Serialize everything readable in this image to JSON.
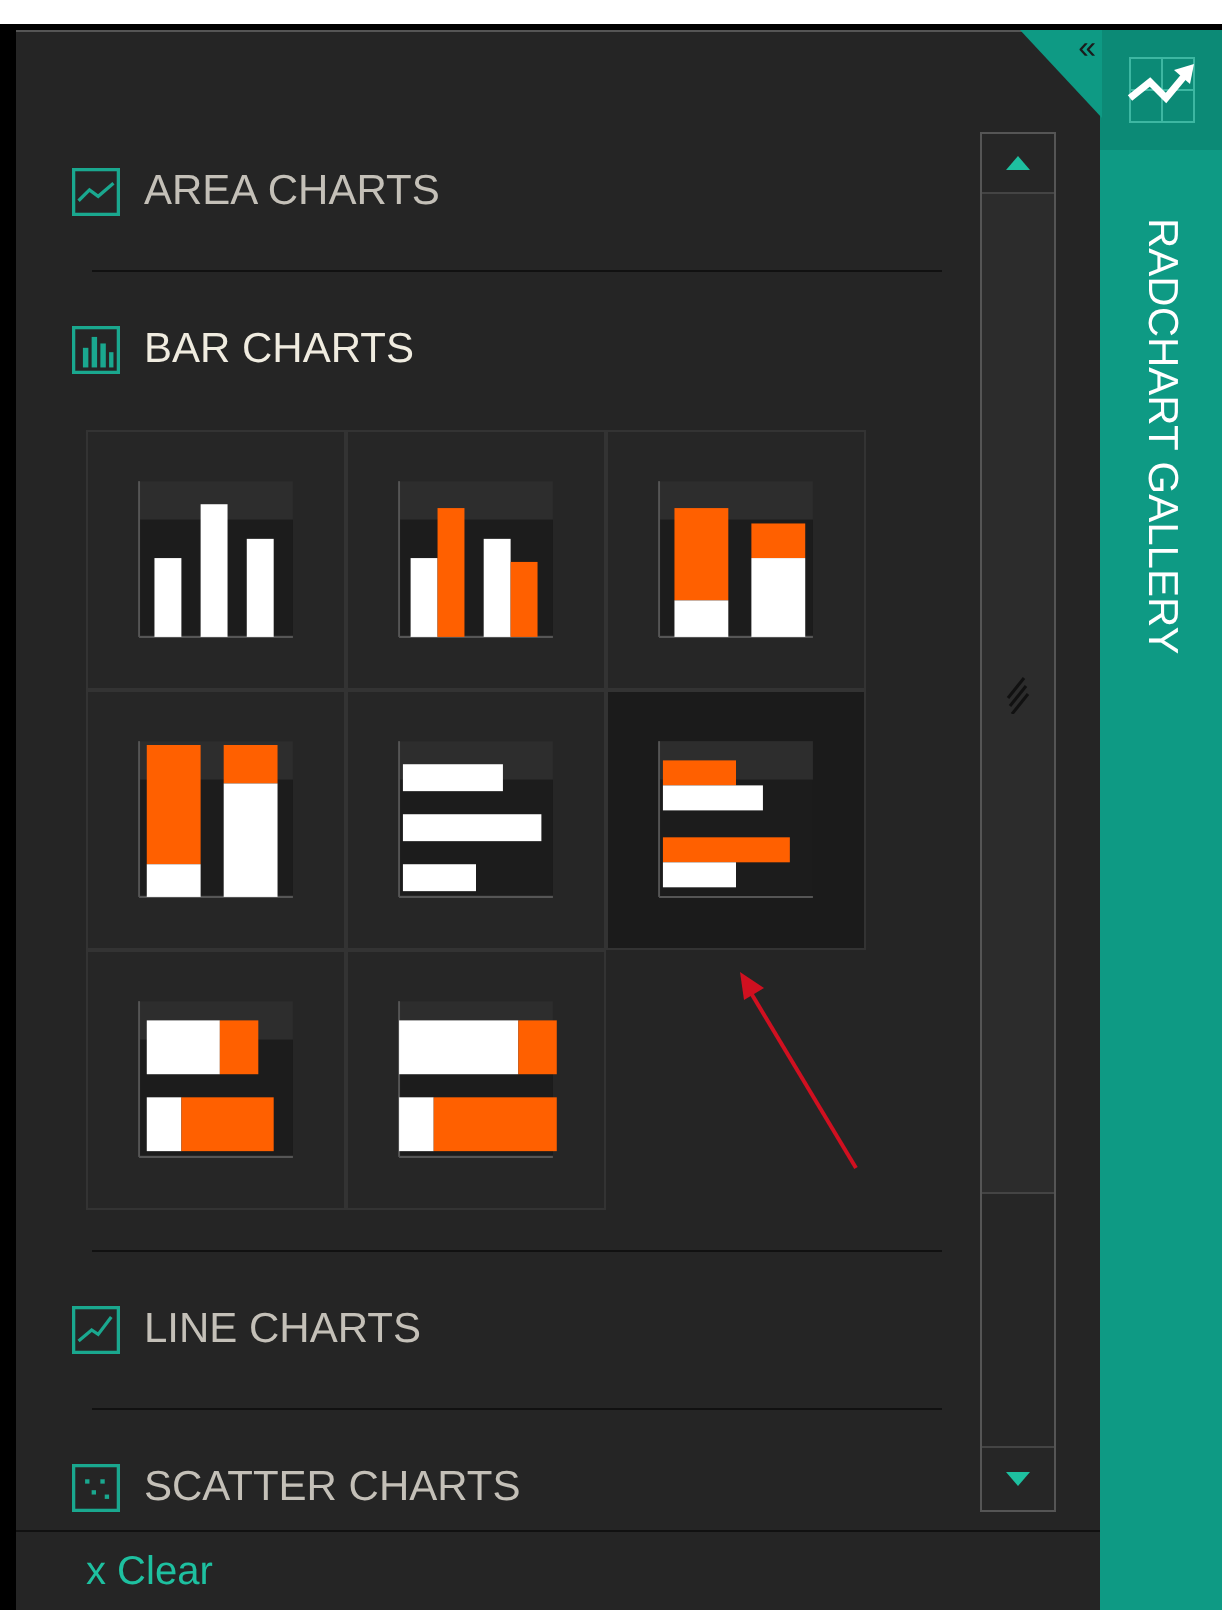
{
  "sections": [
    {
      "kind": "area",
      "label": "AREA CHARTS",
      "expanded": false
    },
    {
      "kind": "bar",
      "label": "BAR CHARTS",
      "expanded": true,
      "thumbnails": [
        {
          "kind": "column",
          "selected": false
        },
        {
          "kind": "clustered-column",
          "selected": false
        },
        {
          "kind": "stacked-column",
          "selected": false
        },
        {
          "kind": "stacked-column-100",
          "selected": false
        },
        {
          "kind": "bar",
          "selected": false
        },
        {
          "kind": "clustered-bar",
          "selected": true
        },
        {
          "kind": "stacked-bar",
          "selected": false
        },
        {
          "kind": "stacked-bar-100",
          "selected": false
        }
      ]
    },
    {
      "kind": "line",
      "label": "LINE CHARTS",
      "expanded": false
    },
    {
      "kind": "scatter",
      "label": "SCATTER CHARTS",
      "expanded": false
    }
  ],
  "clear_link": "x Clear",
  "side_panel": {
    "collapse": "«",
    "title": "RADCHART GALLERY"
  }
}
